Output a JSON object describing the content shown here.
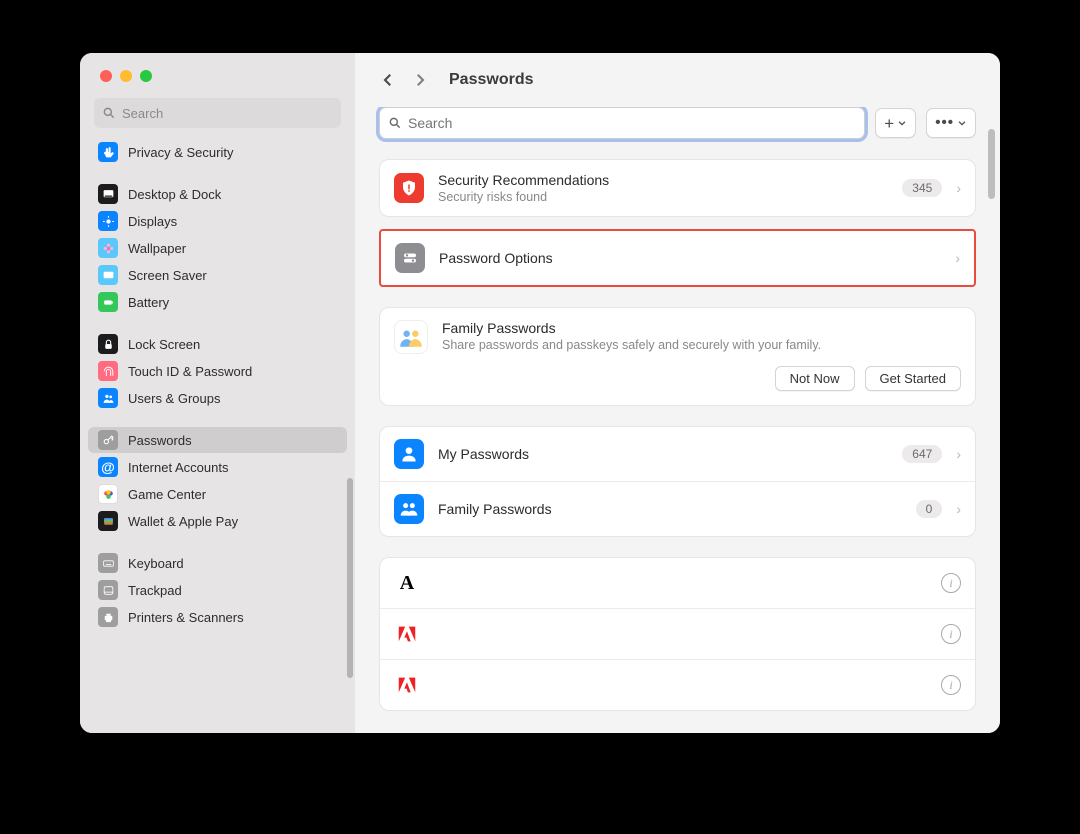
{
  "window": {
    "page_title": "Passwords"
  },
  "sidebar": {
    "search_placeholder": "Search",
    "items": [
      {
        "label": "Privacy & Security",
        "color": "#0a84ff",
        "glyph": "hand"
      },
      {
        "sep": true
      },
      {
        "label": "Desktop & Dock",
        "color": "#1c1c1e",
        "glyph": "dock"
      },
      {
        "label": "Displays",
        "color": "#0a84ff",
        "glyph": "sun"
      },
      {
        "label": "Wallpaper",
        "color": "#5ac8fa",
        "glyph": "flower"
      },
      {
        "label": "Screen Saver",
        "color": "#5ac8fa",
        "glyph": "screen"
      },
      {
        "label": "Battery",
        "color": "#34c759",
        "glyph": "battery"
      },
      {
        "sep": true
      },
      {
        "label": "Lock Screen",
        "color": "#1c1c1e",
        "glyph": "lock"
      },
      {
        "label": "Touch ID & Password",
        "color": "#ff6b81",
        "glyph": "finger"
      },
      {
        "label": "Users & Groups",
        "color": "#0a84ff",
        "glyph": "users"
      },
      {
        "sep": true
      },
      {
        "label": "Passwords",
        "color": "#9e9e9e",
        "glyph": "key",
        "selected": true
      },
      {
        "label": "Internet Accounts",
        "color": "#0a84ff",
        "glyph": "at"
      },
      {
        "label": "Game Center",
        "color": "#ffffff",
        "glyph": "game",
        "border": true
      },
      {
        "label": "Wallet & Apple Pay",
        "color": "#1c1c1e",
        "glyph": "wallet"
      },
      {
        "sep": true
      },
      {
        "label": "Keyboard",
        "color": "#9e9e9e",
        "glyph": "kb"
      },
      {
        "label": "Trackpad",
        "color": "#9e9e9e",
        "glyph": "tp"
      },
      {
        "label": "Printers & Scanners",
        "color": "#9e9e9e",
        "glyph": "print"
      }
    ]
  },
  "main": {
    "search_placeholder": "Search",
    "sec_rec": {
      "title": "Security Recommendations",
      "sub": "Security risks found",
      "count": "345"
    },
    "pw_options": {
      "title": "Password Options"
    },
    "family_promo": {
      "title": "Family Passwords",
      "sub": "Share passwords and passkeys safely and securely with your family.",
      "not_now": "Not Now",
      "get_started": "Get Started"
    },
    "groups": [
      {
        "title": "My Passwords",
        "count": "647",
        "color": "#0a84ff",
        "glyph": "person"
      },
      {
        "title": "Family Passwords",
        "count": "0",
        "color": "#0a84ff",
        "glyph": "people"
      }
    ],
    "entries": [
      {
        "glyph": "A",
        "color": "#000"
      },
      {
        "glyph": "adobe",
        "color": "#ed2224"
      },
      {
        "glyph": "adobe",
        "color": "#ed2224"
      }
    ]
  }
}
